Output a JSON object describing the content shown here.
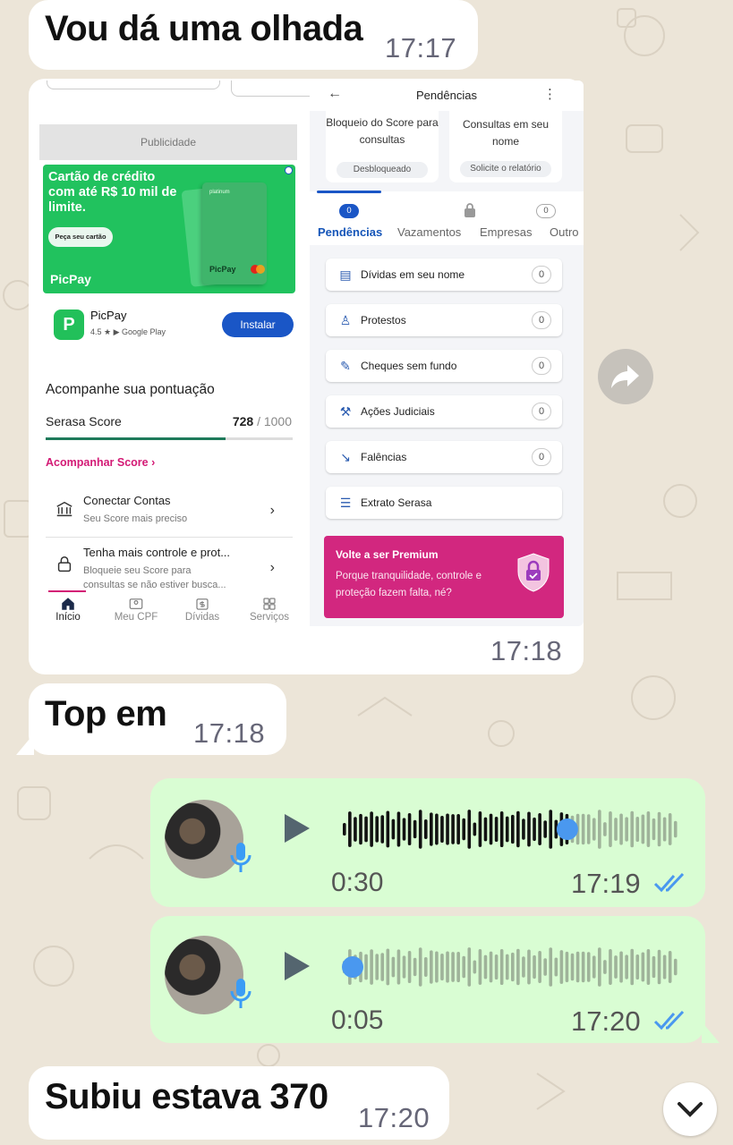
{
  "colors": {
    "incoming_bubble": "#ffffff",
    "outgoing_bubble": "#d9fdd3",
    "read_ticks": "#4a98ef",
    "chat_bg": "#ece5d8"
  },
  "messages": [
    {
      "type": "text",
      "direction": "in",
      "text": "Vou dá uma olhada",
      "time": "17:17"
    },
    {
      "type": "image",
      "direction": "in",
      "time": "17:18"
    },
    {
      "type": "text",
      "direction": "in",
      "text": "Top em",
      "time": "17:18"
    },
    {
      "type": "voice",
      "direction": "out",
      "duration": "0:30",
      "time": "17:19",
      "progress": 0.67
    },
    {
      "type": "voice",
      "direction": "out",
      "duration": "0:05",
      "time": "17:20",
      "progress": 0.0
    },
    {
      "type": "text",
      "direction": "in",
      "text": "Subiu estava 370",
      "time": "17:20"
    }
  ],
  "screenshot": {
    "left": {
      "ad_label": "Publicidade",
      "ad_headline": "Cartão de crédito com até R$ 10 mil de limite.",
      "ad_button": "Peça seu cartão",
      "ad_brand": "PicPay",
      "card_label": "platinum",
      "card_brand": "PicPay",
      "app_icon_glyph": "P",
      "app_name": "PicPay",
      "app_rating": "4.5 ★  ▶ Google Play",
      "install_button": "Instalar",
      "section_title": "Acompanhe sua pontuação",
      "score_label": "Serasa Score",
      "score_value": "728",
      "score_max": "/ 1000",
      "score_fraction": 0.728,
      "score_link": "Acompanhar Score ›",
      "rows": [
        {
          "title": "Conectar Contas",
          "subtitle": "Seu Score mais preciso",
          "chevron": "›"
        },
        {
          "title": "Tenha mais controle e prot...",
          "subtitle": "Bloqueie seu Score para",
          "subtitle2": "consultas se não estiver busca...",
          "chevron": "›"
        }
      ],
      "nav": [
        {
          "label": "Início",
          "icon": "home-icon"
        },
        {
          "label": "Meu CPF",
          "icon": "id-card-icon"
        },
        {
          "label": "Dívidas",
          "icon": "debts-icon"
        },
        {
          "label": "Serviços",
          "icon": "grid-icon"
        }
      ]
    },
    "right": {
      "back_glyph": "←",
      "title": "Pendências",
      "menu_glyph": "⋮",
      "card_a_title": "Bloqueio do Score para consultas",
      "card_a_pill": "Desbloqueado",
      "card_b_title": "Consultas em seu nome",
      "card_b_pill": "Solicite o relatório",
      "tabs": [
        {
          "label": "Pendências",
          "badge": "0"
        },
        {
          "label": "Vazamentos",
          "badge": ""
        },
        {
          "label": "Empresas",
          "badge": "0"
        },
        {
          "label": "Outro",
          "badge": "0"
        }
      ],
      "items": [
        {
          "label": "Dívidas em seu nome",
          "count": "0"
        },
        {
          "label": "Protestos",
          "count": "0"
        },
        {
          "label": "Cheques sem fundo",
          "count": "0"
        },
        {
          "label": "Ações Judiciais",
          "count": "0"
        },
        {
          "label": "Falências",
          "count": "0"
        },
        {
          "label": "Extrato Serasa",
          "count": ""
        }
      ],
      "premium_title": "Volte a ser Premium",
      "premium_text": "Porque tranquilidade, controle e proteção fazem falta, né?"
    }
  }
}
